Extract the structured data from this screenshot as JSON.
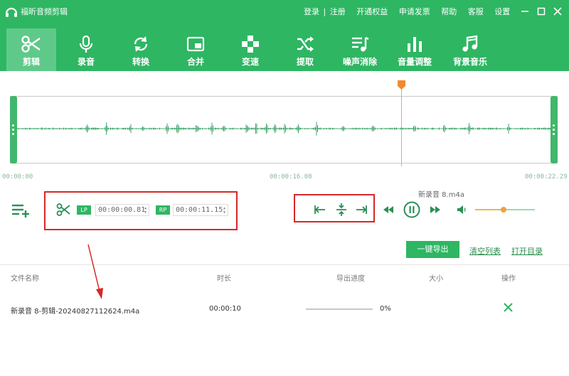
{
  "app": {
    "title": "福昕音频剪辑",
    "links": [
      "登录",
      "注册",
      "开通权益",
      "申请发票",
      "帮助",
      "客服",
      "设置"
    ],
    "link_separator": "|"
  },
  "tabs": [
    {
      "label": "剪辑",
      "icon": "scissors-icon",
      "active": true
    },
    {
      "label": "录音",
      "icon": "microphone-icon"
    },
    {
      "label": "转换",
      "icon": "refresh-icon"
    },
    {
      "label": "合并",
      "icon": "picture-in-picture-icon"
    },
    {
      "label": "变速",
      "icon": "gamepad-icon"
    },
    {
      "label": "提取",
      "icon": "shuffle-icon"
    },
    {
      "label": "噪声消除",
      "icon": "playlist-music-icon"
    },
    {
      "label": "音量调整",
      "icon": "bar-chart-icon"
    },
    {
      "label": "背景音乐",
      "icon": "music-note-icon"
    }
  ],
  "waveform": {
    "start_time": "00:00:00",
    "mid_time": "00:00:16.08",
    "end_time": "00:00:22.29"
  },
  "controls": {
    "lp_tag": "LP",
    "lp_time": "00:00:00.81",
    "rp_tag": "RP",
    "rp_time": "00:00:11.15",
    "current_file": "新录音 8.m4a",
    "volume_level": 0.48
  },
  "actions": {
    "export": "一键导出",
    "clear": "清空列表",
    "open_folder": "打开目录"
  },
  "table": {
    "headers": [
      "文件名称",
      "时长",
      "导出进度",
      "大小",
      "操作"
    ],
    "rows": [
      {
        "name": "新录音 8-剪辑-20240827112624.m4a",
        "duration": "00:00:10",
        "progress": "0%",
        "size": ""
      }
    ]
  },
  "colors": {
    "brand": "#2eb662",
    "active_tab": "#5fc98a",
    "annotation": "#d62828",
    "playhead": "#f0a35e"
  }
}
